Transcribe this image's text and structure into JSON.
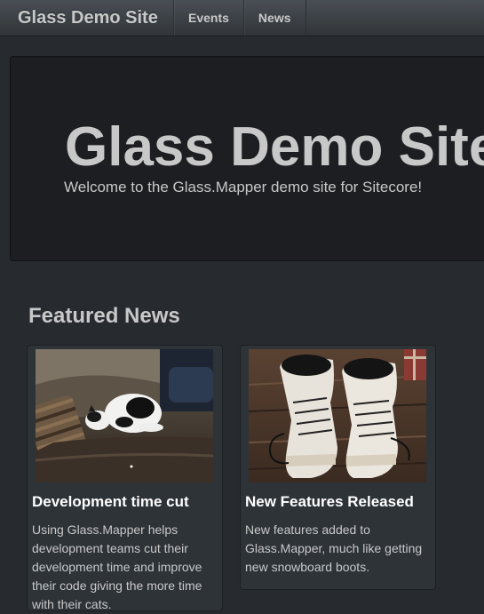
{
  "navbar": {
    "brand": "Glass Demo Site",
    "items": [
      {
        "label": "Events"
      },
      {
        "label": "News"
      }
    ]
  },
  "hero": {
    "title": "Glass Demo Site",
    "subtitle": "Welcome to the Glass.Mapper demo site for Sitecore!"
  },
  "featured": {
    "heading": "Featured News",
    "articles": [
      {
        "title": "Development time cut",
        "body": "Using Glass.Mapper helps development teams cut their development time and improve their code giving the more time with their cats.",
        "image": "cat-sleeping-on-sofa"
      },
      {
        "title": "New Features Released",
        "body": "New features added to Glass.Mapper, much like getting new snowboard boots.",
        "image": "snowboard-boots"
      }
    ]
  },
  "colors": {
    "background": "#272b30",
    "navbar": "#3a3f44",
    "hero": "#1c1e22",
    "card": "#2e3338",
    "text": "#c8c8c8",
    "heading": "#ffffff"
  }
}
